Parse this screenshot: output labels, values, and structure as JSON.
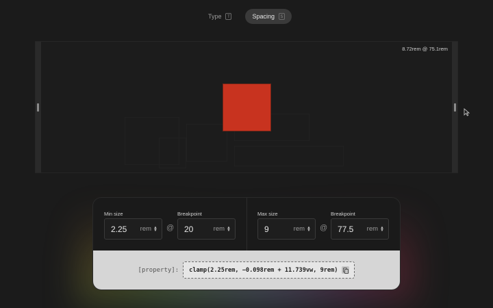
{
  "tabs": [
    {
      "label": "Type",
      "key": "T",
      "active": false
    },
    {
      "label": "Spacing",
      "key": "S",
      "active": true
    }
  ],
  "preview": {
    "size_readout": "8.72rem @ 75.1rem"
  },
  "controls": {
    "min_size": {
      "label": "Min size",
      "value": "2.25",
      "unit": "rem"
    },
    "min_breakpoint": {
      "label": "Breakpoint",
      "value": "20",
      "unit": "rem"
    },
    "max_size": {
      "label": "Max size",
      "value": "9",
      "unit": "rem"
    },
    "max_breakpoint": {
      "label": "Breakpoint",
      "value": "77.5",
      "unit": "rem"
    },
    "at_symbol": "@"
  },
  "output": {
    "property": "[property]:",
    "code": "clamp(2.25rem, −0.098rem + 11.739vw, 9rem)"
  },
  "colors": {
    "accent_square": "#c8331f",
    "background": "#1b1b1b",
    "output_bg": "#d6d6d6"
  },
  "icons": [
    "copy-icon",
    "chevron-updown-icon",
    "cursor-icon",
    "resize-handle-icon"
  ]
}
